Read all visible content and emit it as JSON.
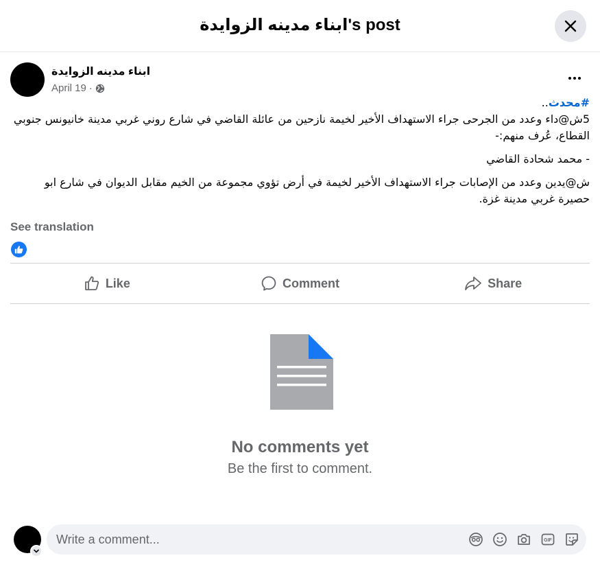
{
  "header": {
    "title": "ابناء مدينه الزوايدة's post"
  },
  "post": {
    "author": "ابناء مدينه الزوايدة",
    "date": "April 19",
    "separator": "·",
    "hashtag": "#محدث",
    "hashtag_suffix": "..",
    "paragraph1": "5ش@داء وعدد من الجرحى جراء الاستهداف الأخير لخيمة نازحين من عائلة القاضي في شارع روني غربي مدينة خانيونس جنوبي القطاع، عُرف منهم:-",
    "paragraph2": "- محمد شحادة القاضي",
    "paragraph3": "ش@يدين وعدد من الإصابات جراء الاستهداف الأخير لخيمة في أرض تؤوي مجموعة من الخيم مقابل الديوان في شارع ابو حصيرة غربي مدينة غزة.",
    "see_translation": "See translation"
  },
  "actions": {
    "like": "Like",
    "comment": "Comment",
    "share": "Share"
  },
  "empty_state": {
    "title": "No comments yet",
    "subtitle": "Be the first to comment."
  },
  "composer": {
    "placeholder": "Write a comment...",
    "icons": [
      "avatar-sticker-icon",
      "emoji-icon",
      "camera-icon",
      "gif-icon",
      "sticker-icon"
    ]
  },
  "colors": {
    "accent": "#1877f2",
    "hashtag": "#0064d1",
    "muted": "#65676b",
    "doc_gray": "#a8aaad"
  }
}
